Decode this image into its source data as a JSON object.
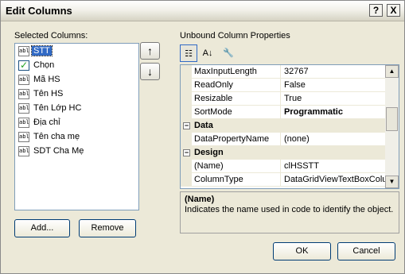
{
  "window": {
    "title": "Edit Columns",
    "help_label": "?",
    "close_label": "X"
  },
  "left": {
    "label": "Selected Columns:",
    "items": [
      {
        "text": "STT",
        "icon": "abl",
        "selected": true
      },
      {
        "text": "Chọn",
        "icon": "check"
      },
      {
        "text": "Mã HS",
        "icon": "abl"
      },
      {
        "text": "Tên HS",
        "icon": "abl"
      },
      {
        "text": "Tên Lớp HC",
        "icon": "abl"
      },
      {
        "text": "Địa chỉ",
        "icon": "abl"
      },
      {
        "text": "Tên cha mẹ",
        "icon": "abl"
      },
      {
        "text": "SDT Cha Mẹ",
        "icon": "abl"
      }
    ],
    "move_up_icon": "↑",
    "move_down_icon": "↓",
    "add_label": "Add...",
    "remove_label": "Remove"
  },
  "right": {
    "label": "Unbound Column Properties",
    "toolbar": {
      "categorized_icon": "categorized-icon",
      "alpha_icon": "alphabetical-icon",
      "pages_icon": "property-pages-icon"
    },
    "properties": [
      {
        "name": "MaxInputLength",
        "value": "32767"
      },
      {
        "name": "ReadOnly",
        "value": "False"
      },
      {
        "name": "Resizable",
        "value": "True"
      },
      {
        "name": "SortMode",
        "value": "Programmatic"
      }
    ],
    "cat_data": "Data",
    "data_props": [
      {
        "name": "DataPropertyName",
        "value": "(none)"
      }
    ],
    "cat_design": "Design",
    "design_props": [
      {
        "name": "(Name)",
        "value": "clHSSTT"
      },
      {
        "name": "ColumnType",
        "value": "DataGridViewTextBoxColu"
      }
    ],
    "description": {
      "title": "(Name)",
      "text": "Indicates the name used in code to identify the object."
    }
  },
  "footer": {
    "ok_label": "OK",
    "cancel_label": "Cancel"
  }
}
